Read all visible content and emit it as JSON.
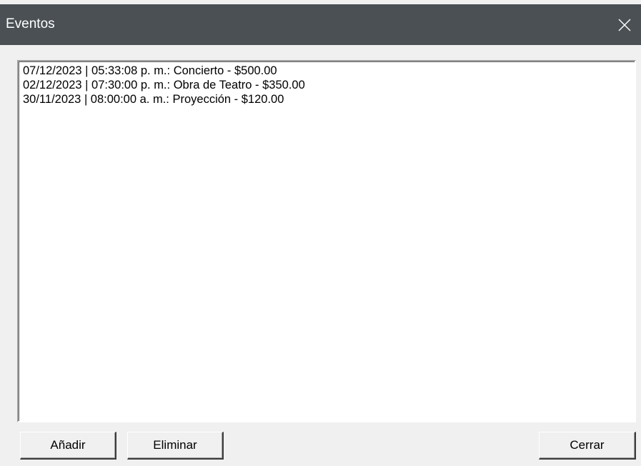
{
  "window": {
    "title": "Eventos",
    "close_icon": "close-icon",
    "titlebar_color": "#4b5054"
  },
  "events_list": {
    "items": [
      "07/12/2023 | 05:33:08 p. m.: Concierto - $500.00",
      "02/12/2023 | 07:30:00 p. m.: Obra de Teatro - $350.00",
      "30/11/2023 | 08:00:00 a. m.: Proyección - $120.00"
    ]
  },
  "buttons": {
    "add_label": "Añadir",
    "delete_label": "Eliminar",
    "close_label": "Cerrar"
  }
}
